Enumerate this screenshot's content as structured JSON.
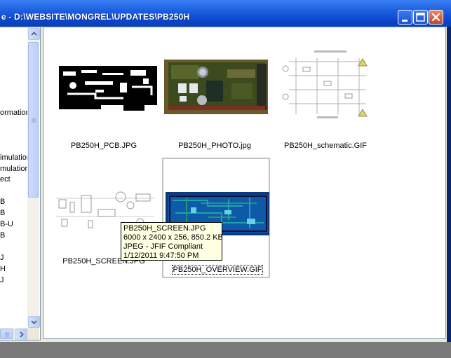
{
  "window": {
    "title": "e - D:\\WEBSITE\\MONGREL\\UPDATES\\PB250H",
    "buttons": {
      "minimize": "minimize",
      "maximize": "maximize",
      "close": "close"
    }
  },
  "tree": {
    "items": [
      {
        "label": "ormation"
      },
      {
        "label": "imulation"
      },
      {
        "label": "mulation"
      },
      {
        "label": "ect"
      },
      {
        "label": "B"
      },
      {
        "label": "B"
      },
      {
        "label": "B-U"
      },
      {
        "label": "B"
      },
      {
        "label": ""
      },
      {
        "label": "J"
      },
      {
        "label": "H"
      },
      {
        "label": "J"
      }
    ]
  },
  "thumbnails": [
    {
      "caption": "PB250H_PCB.JPG",
      "icon": "pcb-layout-image"
    },
    {
      "caption": "PB250H_PHOTO.jpg",
      "icon": "board-photo-image"
    },
    {
      "caption": "PB250H_schematic.GIF",
      "icon": "schematic-image"
    },
    {
      "caption": "PB250H_SCREEN.JPG",
      "icon": "screen-layout-image"
    },
    {
      "caption": "PB250H_OVERVIEW.GIF",
      "icon": "overview-image"
    }
  ],
  "tooltip": {
    "name": "PB250H_SCREEN.JPG",
    "dimensions": "6000 x 2400 x 256, 850.2 KB",
    "type": "JPEG - JFIF Compliant",
    "date": "1/12/2011 9:47:50 PM"
  },
  "colors": {
    "titlebar": "#0b45c9",
    "pcb_board": "#0b3a80",
    "tooltip_bg": "#ffffe1"
  }
}
